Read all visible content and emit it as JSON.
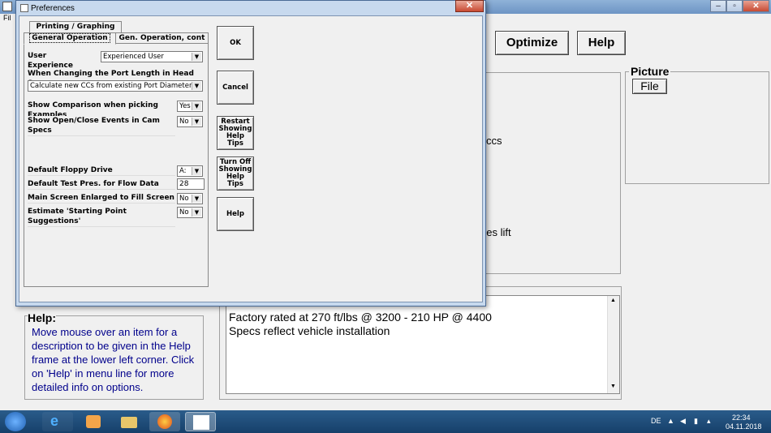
{
  "main_window": {
    "menu_first": "Fil",
    "buttons": {
      "optimize": "Optimize",
      "help": "Help"
    },
    "picture_group": {
      "title": "Picture",
      "file_button": "File"
    },
    "partial_texts": {
      "ccs": "ccs",
      "lift": "hes lift"
    },
    "help_panel": {
      "title": "Help:",
      "text": "Move mouse over an item for a description to be given in the Help frame at the lower left corner. Click on 'Help' in menu line for more detailed info on options."
    },
    "notes": {
      "line1": "Factory rated at 270 ft/lbs @ 3200 - 210 HP @ 4400",
      "line2": "Specs reflect vehicle installation"
    }
  },
  "dialog": {
    "title": "Preferences",
    "close_glyph": "✕",
    "tabs": {
      "printing": "Printing / Graphing",
      "general": "General Operation",
      "general_cont": "Gen. Operation, cont"
    },
    "fields": {
      "user_experience": {
        "label": "User Experience",
        "value": "Experienced User"
      },
      "port_length": {
        "label": "When Changing the Port Length in Head Specs",
        "value": "Calculate new CCs from existing Port Diameter"
      },
      "show_comparison": {
        "label": "Show Comparison when picking  Examples",
        "value": "Yes"
      },
      "show_open_close": {
        "label": "Show Open/Close Events in Cam Specs",
        "value": "No"
      },
      "floppy": {
        "label": "Default Floppy Drive",
        "value": "A:"
      },
      "test_pres": {
        "label": "Default Test Pres. for Flow Data",
        "value": "28"
      },
      "enlarged": {
        "label": "Main Screen Enlarged to Fill Screen",
        "value": "No"
      },
      "starting_point": {
        "label": "Estimate 'Starting Point Suggestions'",
        "value": "No"
      }
    },
    "buttons": {
      "ok": "OK",
      "cancel": "Cancel",
      "restart_tips": "Restart Showing Help Tips",
      "turn_off_tips": "Turn Off Showing Help Tips",
      "help": "Help"
    }
  },
  "taskbar": {
    "language": "DE",
    "time": "22:34",
    "date": "04.11.2018"
  }
}
